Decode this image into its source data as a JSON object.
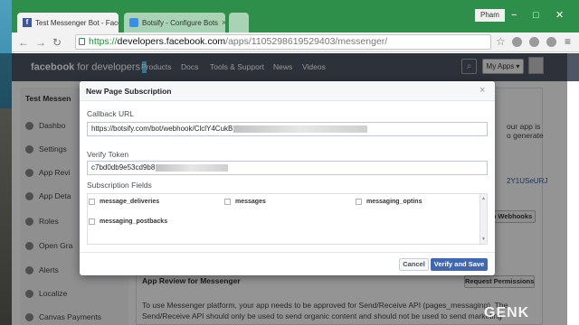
{
  "browser": {
    "tabs": [
      {
        "title": "Test Messenger Bot - Face",
        "close": "×"
      },
      {
        "title": "Botsify - Configure Bots",
        "close": "×"
      }
    ],
    "profile": "Pham",
    "url": {
      "scheme": "https://",
      "host": "developers.facebook.com",
      "path": "/apps/1105298619529403/messenger/"
    }
  },
  "fb_nav": {
    "logo_word": "facebook",
    "logo_rest": "for developers",
    "links": [
      "Products",
      "Docs",
      "Tools & Support",
      "News",
      "Videos"
    ],
    "my_apps": "My Apps ▾"
  },
  "sidebar": {
    "app_name": "Test Messen",
    "items": [
      "Dashbo",
      "Settings",
      "App Revi",
      "App Deta",
      "Roles",
      "Open Gra",
      "Alerts",
      "Localize",
      "Canvas Payments"
    ]
  },
  "background": {
    "right_text_1": "our app is",
    "right_text_2": "o generate",
    "token_fragment": "2Y1USeURJ",
    "setup_webhooks": "p Webhooks",
    "review_title": "App Review for Messenger",
    "request_permissions": "Request Permissions",
    "review_line_1": "To use Messenger platform, your app needs to be approved for Send/Receive API (pages_messaging). The",
    "review_line_2": "Send/Receive API should only be used to send organic content and should not be used to send marketing"
  },
  "watermark": "GENK",
  "modal": {
    "title": "New Page Subscription",
    "close": "×",
    "callback_label": "Callback URL",
    "callback_value": "https://botsify.com/bot/webhook/ClclY4CukB",
    "token_label": "Verify Token",
    "token_value": "c7bd0db9e53cd9b8",
    "fields_label": "Subscription Fields",
    "fields": [
      "message_deliveries",
      "messages",
      "messaging_optins",
      "messaging_postbacks"
    ],
    "cancel": "Cancel",
    "submit": "Verify and Save"
  },
  "colors": {
    "browser_frame": "#2e8f4a",
    "fb_nav": "#4e5665",
    "primary_button": "#4267b2"
  }
}
